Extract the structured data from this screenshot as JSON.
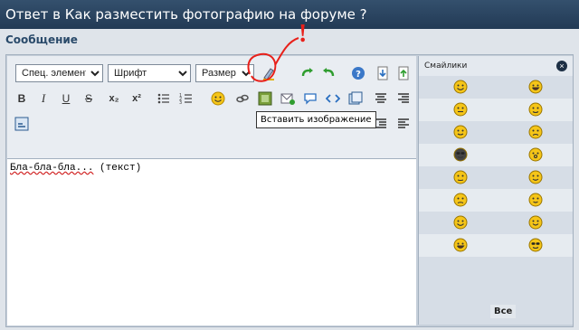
{
  "title": "Ответ в Как разместить фотографию на форуме ?",
  "section_heading": "Сообщение",
  "toolbar": {
    "special_elements": "Спец. элементы",
    "font": "Шрифт",
    "size": "Размер",
    "bold": "B",
    "italic": "I",
    "underline": "U",
    "strike": "S",
    "subscript": "x₂",
    "superscript": "x²"
  },
  "editor_text_a": "Бла-бла-бла...",
  "editor_text_b": " (текст)",
  "tooltip": "Вставить изображение",
  "smilies": {
    "title": "Смайлики",
    "all_button": "Все"
  },
  "annotation_mark": "!",
  "colors": {
    "titlebar": "#2b4563",
    "accent_red": "#e8201a",
    "smiley_yellow": "#f5c518"
  }
}
